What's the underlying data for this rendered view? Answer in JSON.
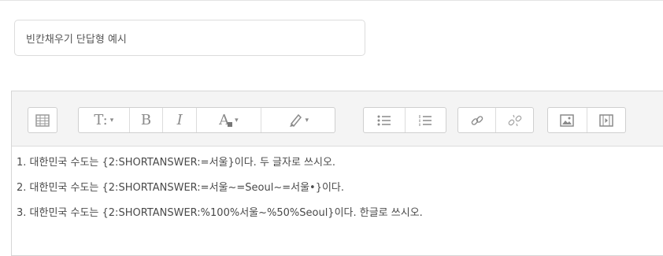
{
  "question_name": {
    "value": "빈칸채우기 단답형 예시"
  },
  "toolbar": {
    "buttons": [
      {
        "name": "toolbar-toggle-button",
        "icon": "toolbar-toggle-icon"
      },
      {
        "name": "paragraph-style-button",
        "icon": "paragraph-style-icon",
        "label": "T:"
      },
      {
        "name": "bold-button",
        "icon": "bold-icon",
        "label": "B"
      },
      {
        "name": "italic-button",
        "icon": "italic-icon",
        "label": "I"
      },
      {
        "name": "font-color-button",
        "icon": "font-color-icon",
        "label": "A"
      },
      {
        "name": "background-color-button",
        "icon": "highlighter-icon"
      },
      {
        "name": "unordered-list-button",
        "icon": "bullet-list-icon"
      },
      {
        "name": "ordered-list-button",
        "icon": "numbered-list-icon"
      },
      {
        "name": "insert-link-button",
        "icon": "link-icon"
      },
      {
        "name": "unlink-button",
        "icon": "unlink-icon"
      },
      {
        "name": "insert-image-button",
        "icon": "image-icon"
      },
      {
        "name": "insert-media-button",
        "icon": "media-icon"
      }
    ],
    "caret": "▾"
  },
  "content": {
    "lines": [
      "1. 대한민국 수도는 {2:SHORTANSWER:=서울}이다. 두 글자로 쓰시오.",
      "2. 대한민국 수도는 {2:SHORTANSWER:=서울~=Seoul~=서울•}이다.",
      "3. 대한민국 수도는 {2:SHORTANSWER:%100%서울~%50%Seoul}이다. 한글로 쓰시오."
    ]
  }
}
